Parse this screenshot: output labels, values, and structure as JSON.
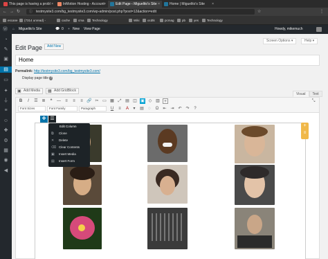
{
  "browser": {
    "tabs": [
      {
        "label": "This page is having a probl",
        "active": false,
        "color": "#d44"
      },
      {
        "label": "InMotion Hosting - Account",
        "active": false,
        "color": "#e86"
      },
      {
        "label": "Edit Page ‹ Miguelito's Site",
        "active": true,
        "color": "#21759b"
      },
      {
        "label": "Home | Miguelito's Site",
        "active": false,
        "color": "#21759b"
      }
    ],
    "url": "testmysite3.com/bg_testmysite3.com/wp-admin/post.php?post=12&action=edit",
    "bookmarks": [
      "escane",
      "(7314 unread) -",
      "cache",
      "cma",
      "Technology",
      "Wiki",
      "ocdtk",
      "pcmag",
      "pb",
      "yes",
      "Technology"
    ]
  },
  "adminbar": {
    "site_name": "Miguelito's Site",
    "comments": "0",
    "new_label": "New",
    "view_label": "View Page",
    "greeting": "Howdy, mikemuch"
  },
  "header": {
    "title": "Edit Page",
    "add_new": "Add New",
    "screen_options": "Screen Options ▾",
    "help": "Help ▾"
  },
  "post": {
    "title_value": "Home",
    "permalink_label": "Permalink:",
    "permalink_url": "http://testmysite3.com/bg_testmysite3.com/",
    "display_title": "Display page title"
  },
  "editor": {
    "add_media": "Add Media",
    "add_gridblock": "Add GridBlock",
    "tab_visual": "Visual",
    "tab_text": "Text",
    "font_sizes": "Font Sizes",
    "font_family": "Font Family",
    "paragraph": "Paragraph"
  },
  "grid_menu": {
    "items": [
      "Edit Column",
      "Clone",
      "Delete",
      "Clear Contents",
      "Insert Media",
      "Insert Form"
    ]
  }
}
